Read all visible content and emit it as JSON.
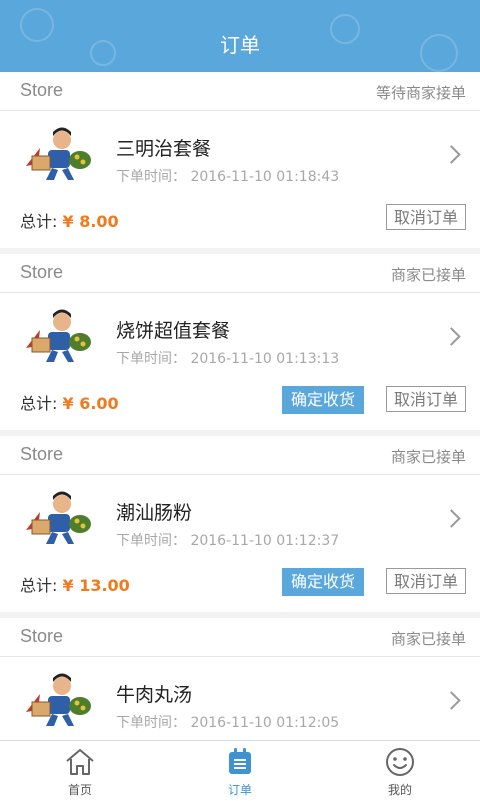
{
  "header": {
    "title": "订单"
  },
  "orders": [
    {
      "store": "Store",
      "status": "等待商家接单",
      "name": "三明治套餐",
      "time": "下单时间：  2016-11-10 01:18:43",
      "total_label": "总计:",
      "total": "¥ 8.00",
      "cancel_label": "取消订单",
      "confirm_label": ""
    },
    {
      "store": "Store",
      "status": "商家已接单",
      "name": "烧饼超值套餐",
      "time": "下单时间：  2016-11-10 01:13:13",
      "total_label": "总计:",
      "total": "¥ 6.00",
      "cancel_label": "取消订单",
      "confirm_label": "确定收货"
    },
    {
      "store": "Store",
      "status": "商家已接单",
      "name": "潮汕肠粉",
      "time": "下单时间：  2016-11-10 01:12:37",
      "total_label": "总计:",
      "total": "¥ 13.00",
      "cancel_label": "取消订单",
      "confirm_label": "确定收货"
    },
    {
      "store": "Store",
      "status": "商家已接单",
      "name": "牛肉丸汤",
      "time": "下单时间：  2016-11-10 01:12:05",
      "total_label": "",
      "total": "",
      "cancel_label": "",
      "confirm_label": ""
    }
  ],
  "tabs": [
    {
      "label": "首页",
      "icon": "home-icon",
      "active": false
    },
    {
      "label": "订单",
      "icon": "orders-icon",
      "active": true
    },
    {
      "label": "我的",
      "icon": "smiley-icon",
      "active": false
    }
  ],
  "colors": {
    "accent": "#5aa7db",
    "price": "#f07a1c"
  }
}
